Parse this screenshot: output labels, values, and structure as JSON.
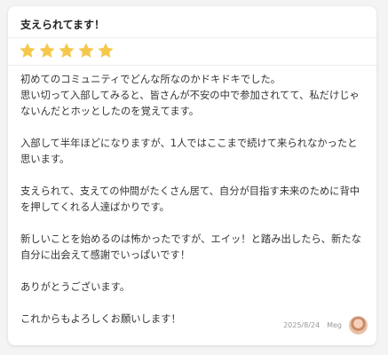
{
  "review": {
    "title": "支えられてます！",
    "rating": 5,
    "paragraphs": [
      "初めてのコミュニティでどんな所なのかドキドキでした。\n思い切って入部してみると、皆さんが不安の中で参加されてて、私だけじゃないんだとホッとしたのを覚えてます。",
      "入部して半年ほどになりますが、1人ではここまで続けて来られなかったと思います。",
      "支えられて、支えての仲間がたくさん居て、自分が目指す未来のために背中を押してくれる人達ばかりです。",
      "新しいことを始めるのは怖かったですが、エイッ！と踏み出したら、新たな自分に出会えて感謝でいっぱいです！",
      "ありがとうございます。",
      "これからもよろしくお願いします！"
    ],
    "date": "2025/8/24",
    "author": "Meg"
  },
  "colors": {
    "star": "#f5c84c",
    "card_bg": "#ffffff",
    "page_bg": "#f4f4f4"
  },
  "icons": {
    "star": "star-icon",
    "avatar": "user-avatar"
  }
}
